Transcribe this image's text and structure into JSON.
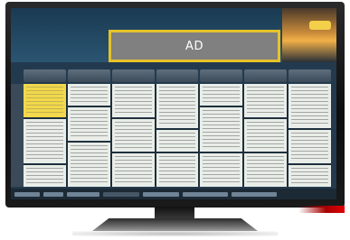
{
  "ad": {
    "label": "AD"
  },
  "colors": {
    "ad_border": "#e6c22a",
    "ad_fill": "#808080",
    "screen_bg": "#233a4e",
    "highlight_cell": "#f2d84a"
  },
  "icons": [
    "tv-frame-icon",
    "stand-icon"
  ]
}
